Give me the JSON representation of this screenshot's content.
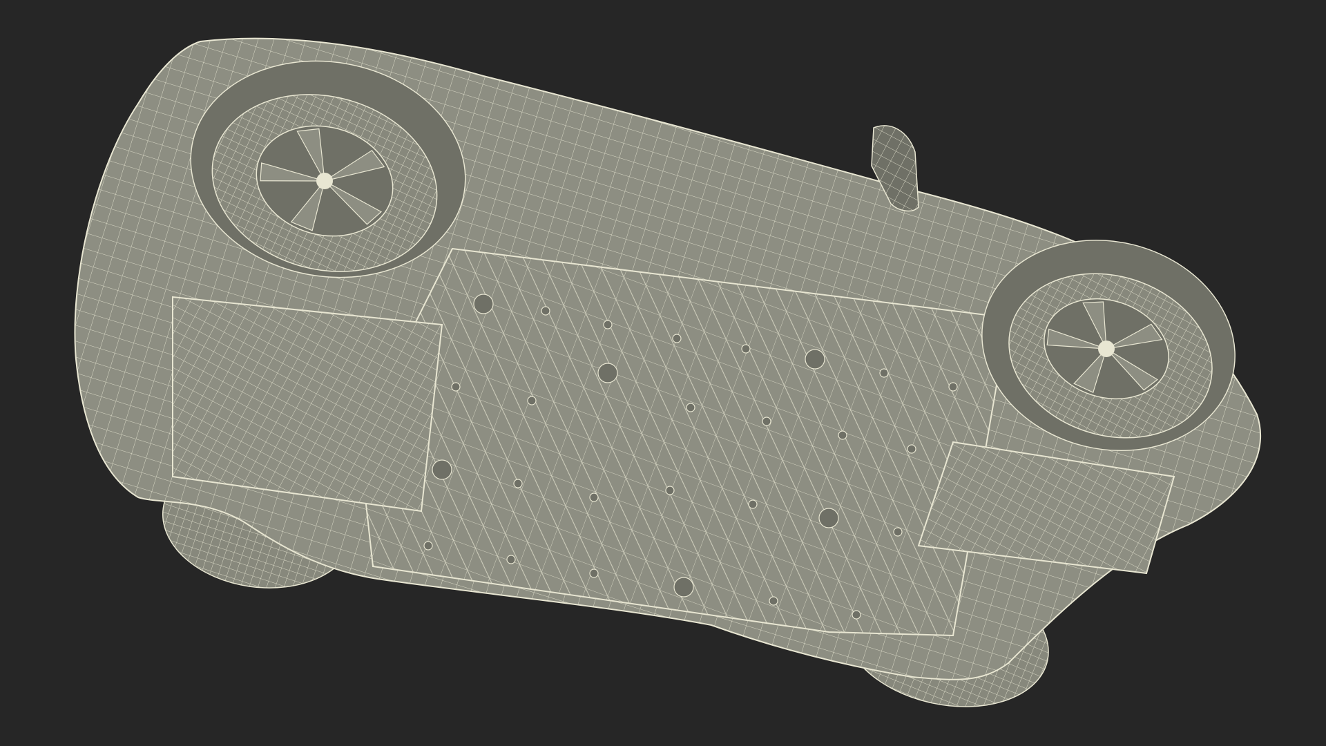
{
  "scene": {
    "subject": "car-wireframe-underside",
    "background_color": "#262626",
    "surface_color": "#8d8e82",
    "surface_shadow_color": "#6f7066",
    "tire_color": "#87887c",
    "wire_color": "#e8e6d2"
  }
}
